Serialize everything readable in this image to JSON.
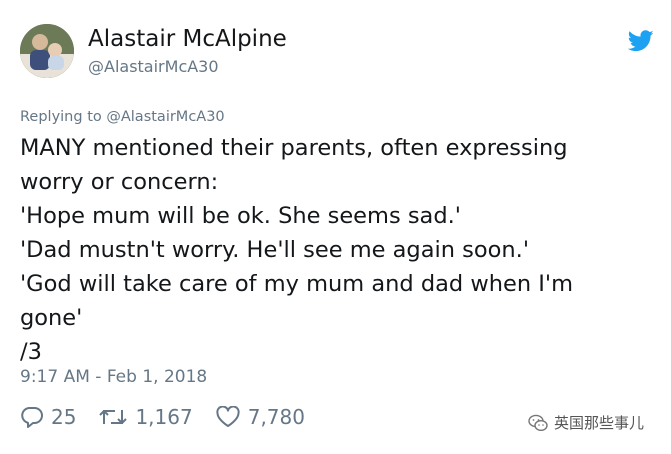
{
  "author": {
    "display_name": "Alastair McAlpine",
    "handle": "@AlastairMcA30"
  },
  "reply": {
    "prefix": "Replying to",
    "handle": "@AlastairMcA30"
  },
  "tweet": {
    "lines": [
      "MANY mentioned their parents, often expressing",
      "worry or concern:",
      "'Hope mum will be ok. She seems sad.'",
      "'Dad mustn't worry. He'll see me again soon.'",
      "'God will take care of my mum and dad when I'm",
      "gone'",
      "/3"
    ],
    "timestamp": "9:17 AM - Feb 1, 2018"
  },
  "actions": {
    "replies": "25",
    "retweets": "1,167",
    "likes": "7,780"
  },
  "watermark": {
    "text": "英国那些事儿"
  },
  "colors": {
    "twitter_blue": "#1da1f2",
    "secondary_text": "#657786",
    "primary_text": "#14171a"
  },
  "icons": {
    "brand": "twitter-bird-icon",
    "reply": "reply-bubble-icon",
    "retweet": "retweet-icon",
    "like": "heart-icon",
    "watermark": "wechat-icon"
  }
}
